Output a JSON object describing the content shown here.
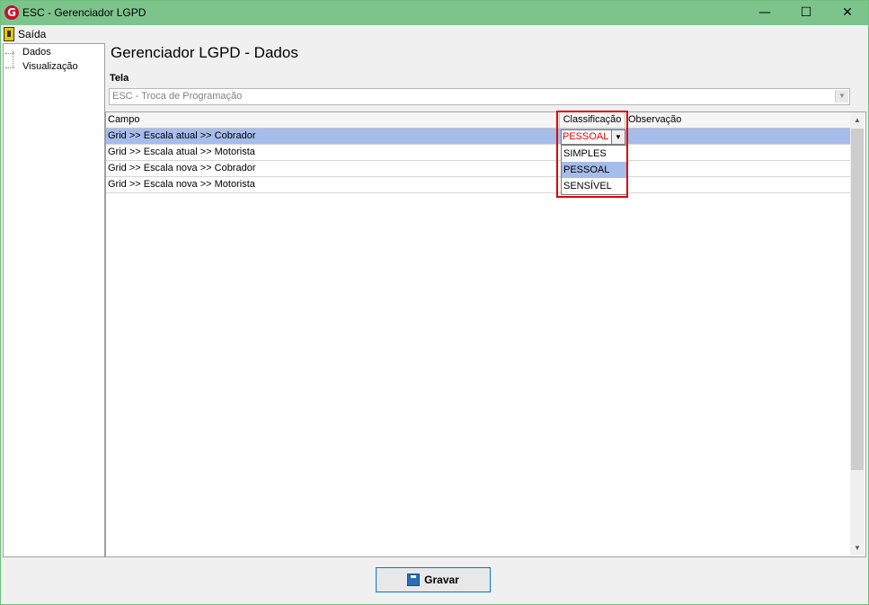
{
  "window": {
    "title": "ESC - Gerenciador LGPD",
    "app_icon": "G",
    "controls": {
      "minimize": "—",
      "maximize": "☐",
      "close": "✕"
    }
  },
  "menu": {
    "exit_label": "Saída"
  },
  "tree": {
    "items": [
      "Dados",
      "Visualização"
    ]
  },
  "page": {
    "title": "Gerenciador LGPD - Dados",
    "tela_label": "Tela",
    "tela_value": "ESC - Troca de Programação"
  },
  "grid": {
    "headers": {
      "campo": "Campo",
      "classificacao": "Classificação",
      "observacao": "Observação"
    },
    "rows": [
      "Grid >> Escala atual >> Cobrador",
      "Grid >> Escala atual >> Motorista",
      "Grid >> Escala nova >> Cobrador",
      "Grid >> Escala nova >> Motorista"
    ],
    "editor_value": "PESSOAL",
    "dropdown_options": [
      "SIMPLES",
      "PESSOAL",
      "SENSÍVEL"
    ]
  },
  "save_label": "Gravar",
  "colors": {
    "titlebar": "#7cc48c",
    "selection": "#a6bcea",
    "highlight": "#e00000"
  },
  "icons": [
    "app-logo-icon",
    "exit-door-icon",
    "floppy-disk-icon",
    "chevron-down-icon"
  ]
}
